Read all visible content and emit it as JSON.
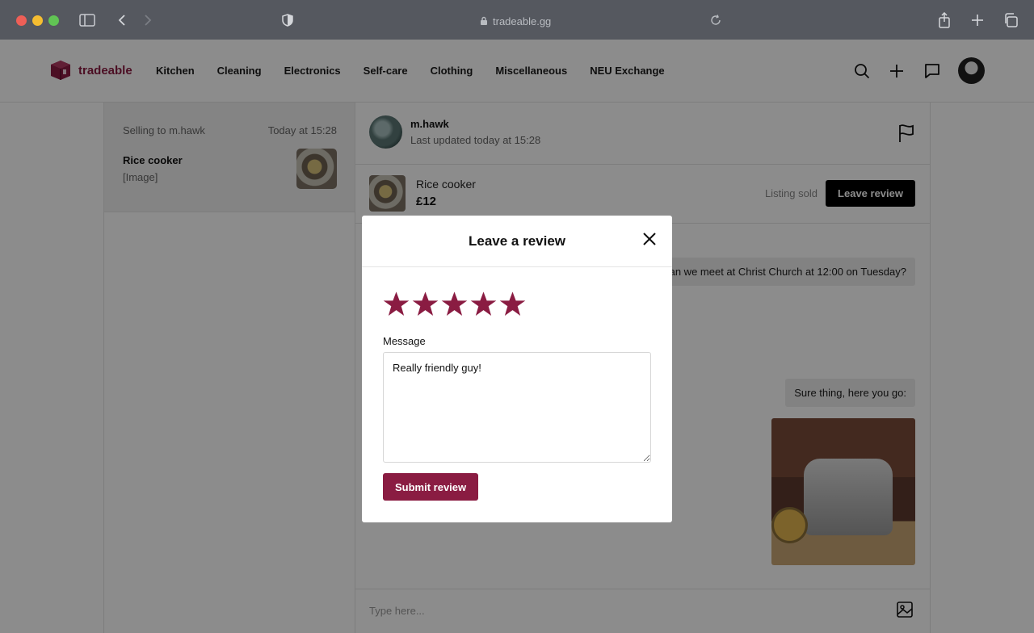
{
  "browser": {
    "url": "tradeable.gg"
  },
  "nav": {
    "brand": "tradeable",
    "links": [
      "Kitchen",
      "Cleaning",
      "Electronics",
      "Self-care",
      "Clothing",
      "Miscellaneous",
      "NEU Exchange"
    ],
    "icons": [
      "search-icon",
      "plus-icon",
      "chat-icon",
      "avatar"
    ]
  },
  "conversation": {
    "title": "Selling to m.hawk",
    "time": "Today at 15:28",
    "item": "Rice cooker",
    "snippet": "[Image]"
  },
  "chat": {
    "user": "m.hawk",
    "updated": "Last updated today at 15:28",
    "listing": {
      "name": "Rice cooker",
      "price": "£12",
      "status": "Listing sold",
      "action": "Leave review"
    },
    "messages": [
      {
        "text": "Can we meet at Christ Church at 12:00 on Tuesday?"
      },
      {
        "text": "Sure thing, here you go:"
      }
    ],
    "composer_placeholder": "Type here..."
  },
  "modal": {
    "title": "Leave a review",
    "rating": 5,
    "message_label": "Message",
    "message_value": "Really friendly guy!",
    "submit_label": "Submit review"
  },
  "colors": {
    "brand": "#8a1c42",
    "primary_button": "#000000"
  }
}
